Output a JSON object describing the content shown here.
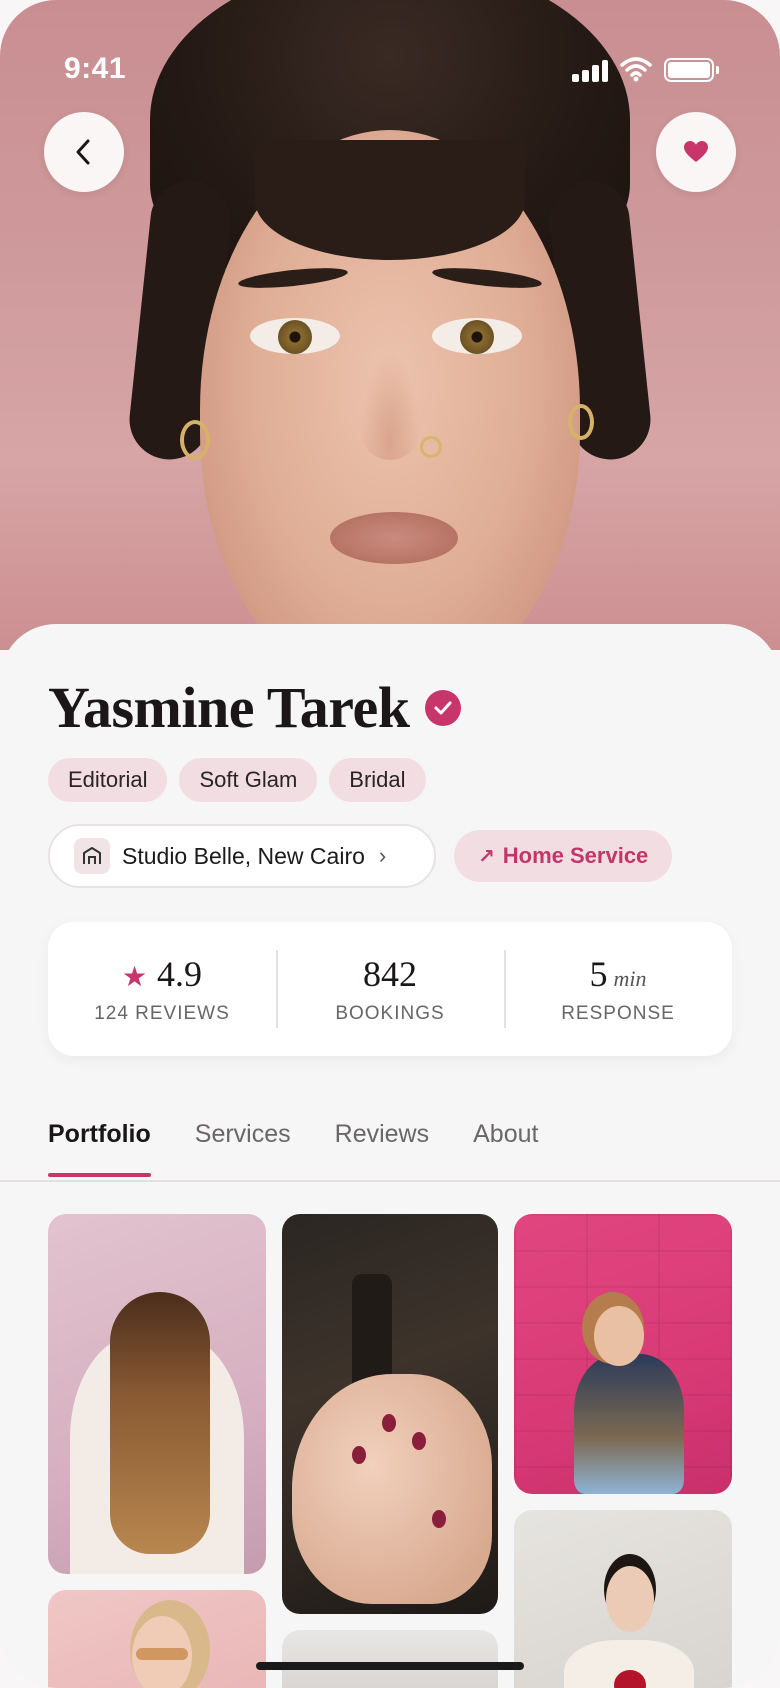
{
  "status_bar": {
    "time": "9:41"
  },
  "hero": {
    "back_icon": "chevron-left-icon",
    "favorite_icon": "heart-icon",
    "favorite_color": "#c7356b"
  },
  "profile": {
    "name": "Yasmine Tarek",
    "verified": true,
    "tags": [
      "Editorial",
      "Soft Glam",
      "Bridal"
    ],
    "location": "Studio Belle, New Cairo",
    "home_service_label": "Home Service"
  },
  "stats": {
    "rating": {
      "value": "4.9",
      "label": "124 REVIEWS"
    },
    "bookings": {
      "value": "842",
      "label": "BOOKINGS"
    },
    "response": {
      "value": "5",
      "unit": "min",
      "label": "RESPONSE"
    }
  },
  "tabs": [
    {
      "label": "Portfolio",
      "active": true
    },
    {
      "label": "Services",
      "active": false
    },
    {
      "label": "Reviews",
      "active": false
    },
    {
      "label": "About",
      "active": false
    }
  ],
  "colors": {
    "accent": "#c7356b",
    "chip_bg": "#f2dde3",
    "background": "#f7f6f6"
  }
}
